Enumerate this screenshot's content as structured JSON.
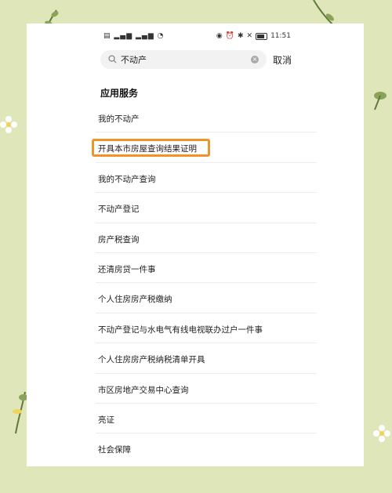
{
  "status_bar": {
    "left_text": "▤ ▂▄▆ ▂▄▆ ◔",
    "time": "11:51"
  },
  "search": {
    "value": "不动产",
    "cancel_label": "取消"
  },
  "section": {
    "title": "应用服务"
  },
  "results": [
    {
      "label": "我的不动产"
    },
    {
      "label": "开具本市房屋查询结果证明"
    },
    {
      "label": "我的不动产查询"
    },
    {
      "label": "不动产登记"
    },
    {
      "label": "房产税查询"
    },
    {
      "label": "还清房贷一件事"
    },
    {
      "label": "个人住房房产税缴纳"
    },
    {
      "label": "不动产登记与水电气有线电视联办过户一件事"
    },
    {
      "label": "个人住房房产税纳税清单开具"
    },
    {
      "label": "市区房地产交易中心查询"
    },
    {
      "label": "亮证"
    },
    {
      "label": "社会保障"
    }
  ],
  "colors": {
    "background": "#dfe6b9",
    "highlight": "#f2922a"
  }
}
